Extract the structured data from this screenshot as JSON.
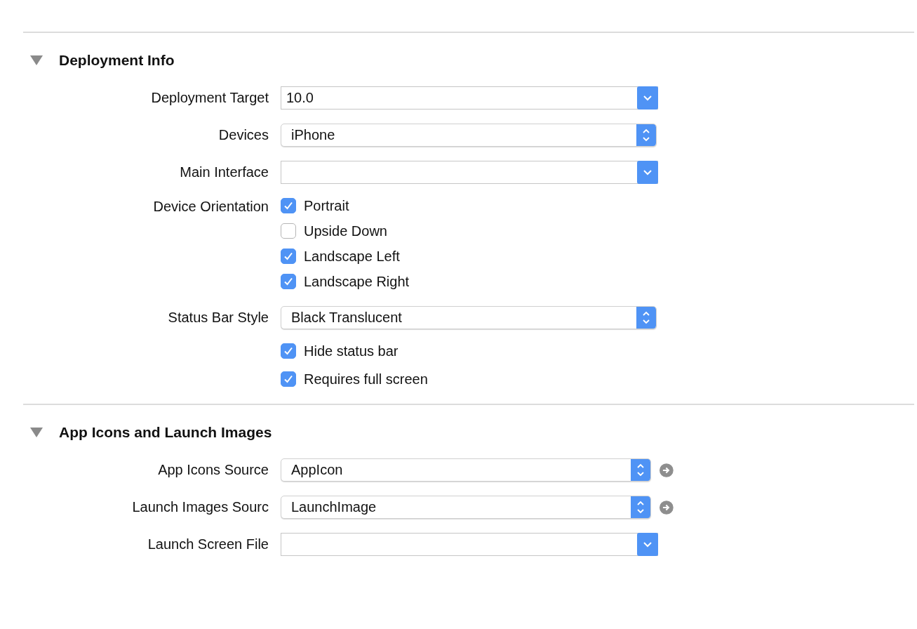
{
  "sections": [
    {
      "title": "Deployment Info",
      "expanded": true,
      "rows": [
        {
          "kind": "combo",
          "label": "Deployment Target",
          "value": "10.0",
          "go_button": false
        },
        {
          "kind": "popup",
          "label": "Devices",
          "value": "iPhone",
          "go_button": false
        },
        {
          "kind": "combo",
          "label": "Main Interface",
          "go_button": false
        },
        {
          "kind": "checks",
          "label": "Device Orientation",
          "options": [
            {
              "label": "Portrait",
              "checked": true
            },
            {
              "label": "Upside Down",
              "checked": false
            },
            {
              "label": "Landscape Left",
              "checked": true
            },
            {
              "label": "Landscape Right",
              "checked": true
            }
          ]
        },
        {
          "kind": "popup",
          "label": "Status Bar Style",
          "value": "Black Translucent",
          "go_button": false
        },
        {
          "kind": "checks",
          "options": [
            {
              "label": "Hide status bar",
              "checked": true
            },
            {
              "label": "Requires full screen",
              "checked": true
            }
          ]
        }
      ]
    },
    {
      "title": "App Icons and Launch Images",
      "expanded": true,
      "rows": [
        {
          "kind": "popup",
          "label": "App Icons Source",
          "value": "AppIcon",
          "go_button": true
        },
        {
          "kind": "popup",
          "label": "Launch Images Sourc",
          "value": "LaunchImage",
          "go_button": true
        },
        {
          "kind": "combo",
          "label": "Launch Screen File",
          "go_button": false
        }
      ]
    }
  ]
}
